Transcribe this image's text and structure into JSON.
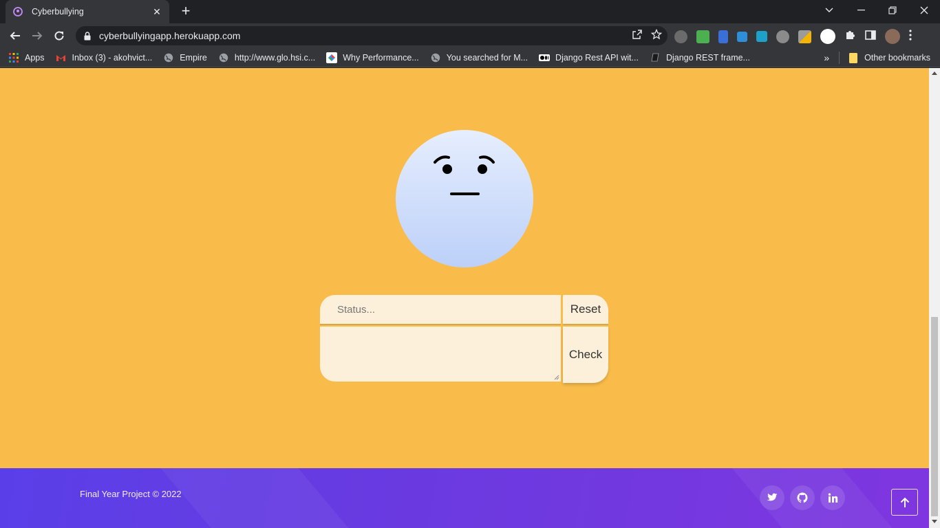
{
  "browser": {
    "tab_title": "Cyberbullying",
    "url": "cyberbullyingapp.herokuapp.com",
    "new_tab": "+",
    "bookmarks": [
      {
        "label": "Apps",
        "icon": "apps-grid-icon"
      },
      {
        "label": "Inbox (3) - akohvict...",
        "icon": "gmail-icon"
      },
      {
        "label": "Empire",
        "icon": "globe-icon"
      },
      {
        "label": "http://www.glo.hsi.c...",
        "icon": "globe-icon"
      },
      {
        "label": "Why Performance...",
        "icon": "google-icon"
      },
      {
        "label": "You searched for M...",
        "icon": "globe-icon"
      },
      {
        "label": "Django Rest API wit...",
        "icon": "medium-icon"
      },
      {
        "label": "Django REST frame...",
        "icon": "book-icon"
      }
    ],
    "more_bookmarks": "»",
    "other_bookmarks": "Other bookmarks"
  },
  "form": {
    "status_placeholder": "Status...",
    "reset_label": "Reset",
    "check_label": "Check"
  },
  "footer": {
    "copyright": "Final Year Project © 2022",
    "social": [
      "twitter-icon",
      "github-icon",
      "linkedin-icon"
    ]
  },
  "colors": {
    "page_bg": "#f9bc4a",
    "input_bg": "#fdf0da",
    "footer_start": "#5a3fe8",
    "footer_end": "#7f36e0"
  }
}
